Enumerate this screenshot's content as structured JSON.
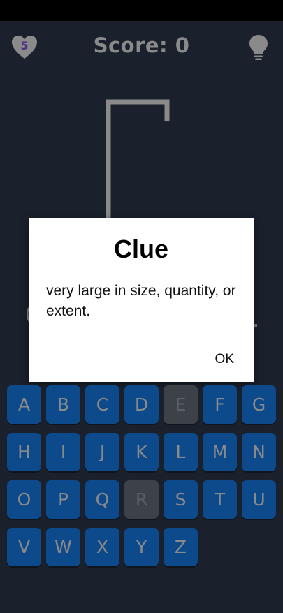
{
  "header": {
    "lives": "5",
    "score_text": "Score: 0"
  },
  "icons": {
    "lives": "heart-icon",
    "hint": "lightbulb-icon"
  },
  "dialog": {
    "title": "Clue",
    "message": "very large in size, quantity, or extent.",
    "ok_label": "OK"
  },
  "keyboard": {
    "keys": [
      {
        "letter": "A",
        "used": false
      },
      {
        "letter": "B",
        "used": false
      },
      {
        "letter": "C",
        "used": false
      },
      {
        "letter": "D",
        "used": false
      },
      {
        "letter": "E",
        "used": true
      },
      {
        "letter": "F",
        "used": false
      },
      {
        "letter": "G",
        "used": false
      },
      {
        "letter": "H",
        "used": false
      },
      {
        "letter": "I",
        "used": false
      },
      {
        "letter": "J",
        "used": false
      },
      {
        "letter": "K",
        "used": false
      },
      {
        "letter": "L",
        "used": false
      },
      {
        "letter": "M",
        "used": false
      },
      {
        "letter": "N",
        "used": false
      },
      {
        "letter": "O",
        "used": false
      },
      {
        "letter": "P",
        "used": false
      },
      {
        "letter": "Q",
        "used": false
      },
      {
        "letter": "R",
        "used": true
      },
      {
        "letter": "S",
        "used": false
      },
      {
        "letter": "T",
        "used": false
      },
      {
        "letter": "U",
        "used": false
      },
      {
        "letter": "V",
        "used": false
      },
      {
        "letter": "W",
        "used": false
      },
      {
        "letter": "X",
        "used": false
      },
      {
        "letter": "Y",
        "used": false
      },
      {
        "letter": "Z",
        "used": false
      }
    ]
  },
  "colors": {
    "background": "#1a212c",
    "key": "#0d4a8c",
    "key_used": "#3d4148",
    "text_gray": "#8a8a8a"
  }
}
